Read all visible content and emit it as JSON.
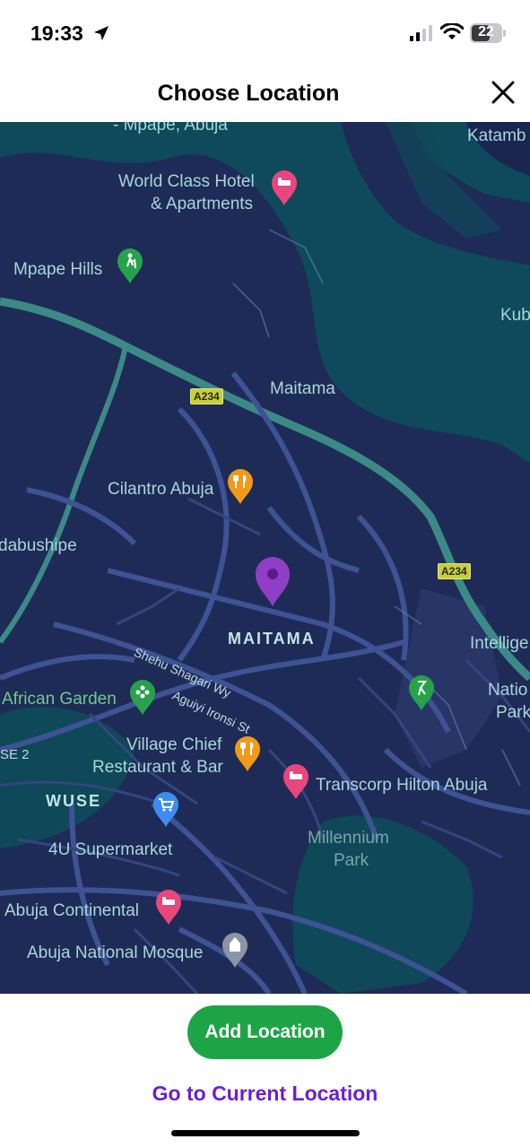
{
  "status_bar": {
    "time": "19:33",
    "battery": "22"
  },
  "header": {
    "title": "Choose Location"
  },
  "map": {
    "labels": {
      "mpape_abuja": "- Mpape, Abuja",
      "world_class_hotel_line1": "World Class Hotel",
      "world_class_hotel_line2": "& Apartments",
      "katamb": "Katamb",
      "mpape_hills": "Mpape Hills",
      "kub": "Kub",
      "a234_top": "A234",
      "maitama": "Maitama",
      "cilantro": "Cilantro Abuja",
      "dabushipe": "dabushipe",
      "a234_right": "A234",
      "maitama_area": "MAITAMA",
      "intellige": "Intellige",
      "shehu_shagari": "Shehu Shagari Wy",
      "african_garden": "African Garden",
      "aguiyi_ironsi": "Aguiyi Ironsi St",
      "natio": "Natio",
      "park_right": "Park",
      "se2": "SE 2",
      "village_chief_line1": "Village Chief",
      "village_chief_line2": "Restaurant & Bar",
      "wuse": "WUSE",
      "transcorp": "Transcorp Hilton Abuja",
      "millennium": "Millennium",
      "millennium_park": "Park",
      "supermarket": "4U Supermarket",
      "abuja_continental": "Abuja Continental",
      "national_mosque": "Abuja National Mosque"
    },
    "selected_pin_color": "#8e3fc4"
  },
  "actions": {
    "add_location": "Add Location",
    "current_location": "Go to Current Location"
  },
  "colors": {
    "accent_green": "#1da446",
    "link_purple": "#6d1ed4",
    "map_water": "#0e4a5c",
    "map_land": "#1f2b57"
  }
}
